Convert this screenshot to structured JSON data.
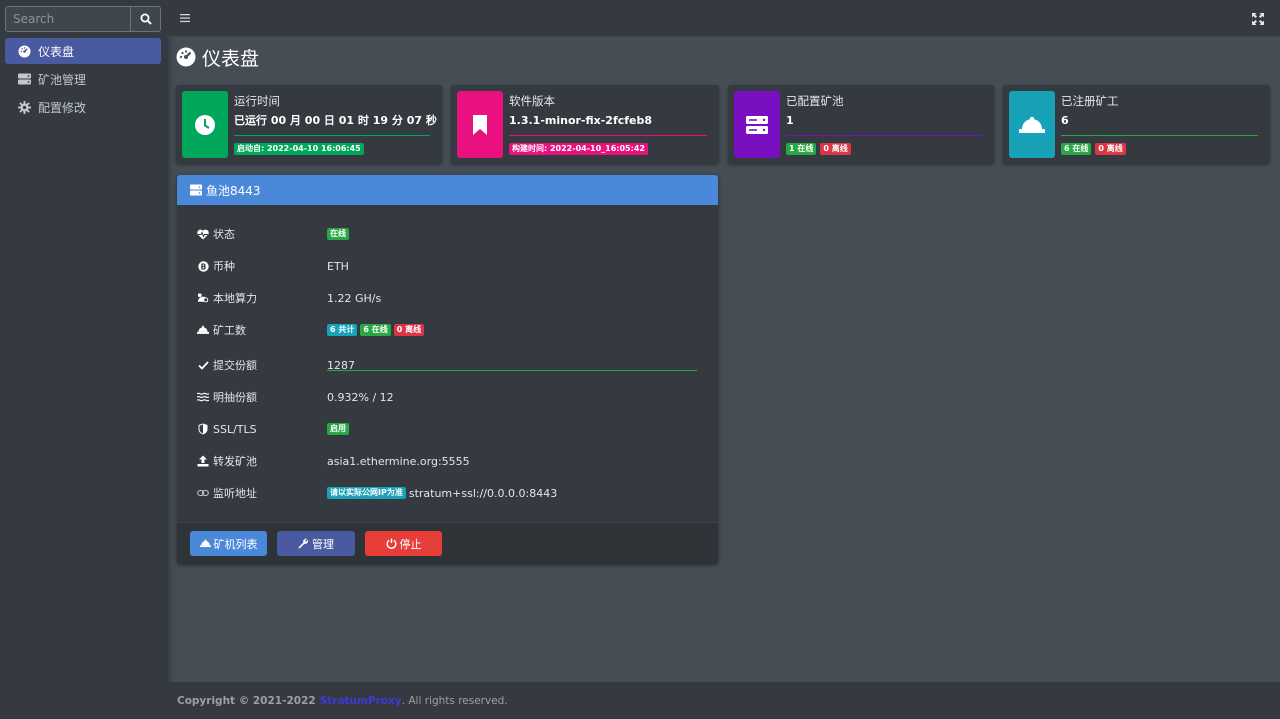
{
  "sidebar": {
    "search": {
      "placeholder": "Search"
    },
    "items": [
      {
        "label": "仪表盘",
        "active": true,
        "icon": "dashboard-icon"
      },
      {
        "label": "矿池管理",
        "active": false,
        "icon": "server-icon"
      },
      {
        "label": "配置修改",
        "active": false,
        "icon": "gear-icon"
      }
    ]
  },
  "page": {
    "title": "仪表盘"
  },
  "info_boxes": [
    {
      "label": "运行时间",
      "value": "已运行 00 月 00 日 01 时 19 分 07 秒",
      "badges": [
        "启动自: 2022-04-10 16:06:45"
      ],
      "color": "#00a65a",
      "icon": "clock-icon"
    },
    {
      "label": "软件版本",
      "value": "1.3.1-minor-fix-2fcfeb8",
      "badges": [
        "构建时间: 2022-04-10_16:05:42"
      ],
      "color": "#e8117f",
      "icon": "bookmark-icon"
    },
    {
      "label": "已配置矿池",
      "value": "1",
      "badges": [
        "1 在线",
        "0 离线"
      ],
      "color": "#7a0fc2",
      "icon": "server-icon"
    },
    {
      "label": "已注册矿工",
      "value": "6",
      "badges": [
        "6 在线",
        "0 离线"
      ],
      "color": "#17a2b8",
      "icon": "hardhat-icon"
    }
  ],
  "pool": {
    "title": "鱼池8443",
    "rows": {
      "status": {
        "label": "状态",
        "badge": "在线"
      },
      "coin": {
        "label": "币种",
        "value": "ETH"
      },
      "hashrate": {
        "label": "本地算力",
        "value": "1.22 GH/s"
      },
      "miners": {
        "label": "矿工数",
        "total": "6 共计",
        "online": "6 在线",
        "offline": "0 离线"
      },
      "shares": {
        "label": "提交份额",
        "value": "1287"
      },
      "fee": {
        "label": "明抽份额",
        "value": "0.932% / 12"
      },
      "ssl": {
        "label": "SSL/TLS",
        "badge": "启用"
      },
      "upstream": {
        "label": "转发矿池",
        "value": "asia1.ethermine.org:5555"
      },
      "listen": {
        "label": "监听地址",
        "badge": "请以实际公网IP为准",
        "value": "stratum+ssl://0.0.0.0:8443"
      }
    },
    "buttons": {
      "miners": "矿机列表",
      "manage": "管理",
      "stop": "停止"
    }
  },
  "footer": {
    "prefix": "Copyright © 2021-2022",
    "brand": "StratumProxy",
    "suffix": ". All rights reserved."
  }
}
